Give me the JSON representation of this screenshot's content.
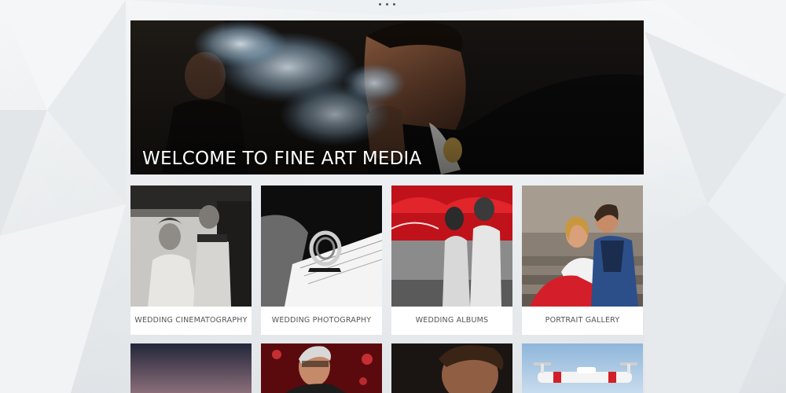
{
  "hero": {
    "title": "WELCOME TO FINE ART MEDIA"
  },
  "tiles": [
    {
      "label": "WEDDING CINEMATOGRAPHY",
      "image": "couple-in-car-bw"
    },
    {
      "label": "WEDDING PHOTOGRAPHY",
      "image": "wedding-rings-on-book"
    },
    {
      "label": "WEDDING ALBUMS",
      "image": "couple-under-red-umbrellas"
    },
    {
      "label": "PORTRAIT GALLERY",
      "image": "couple-sitting-on-steps"
    }
  ],
  "tiles_row2": [
    {
      "image": "dusk-sky"
    },
    {
      "image": "man-speaking-at-microphone"
    },
    {
      "image": "man-portrait-dark"
    },
    {
      "image": "drone-in-sky"
    }
  ],
  "colors": {
    "background": "#eceff1",
    "tile_background": "#ffffff",
    "caption_text": "#555555",
    "hero_text": "#ffffff",
    "accent_red": "#c0121a"
  }
}
